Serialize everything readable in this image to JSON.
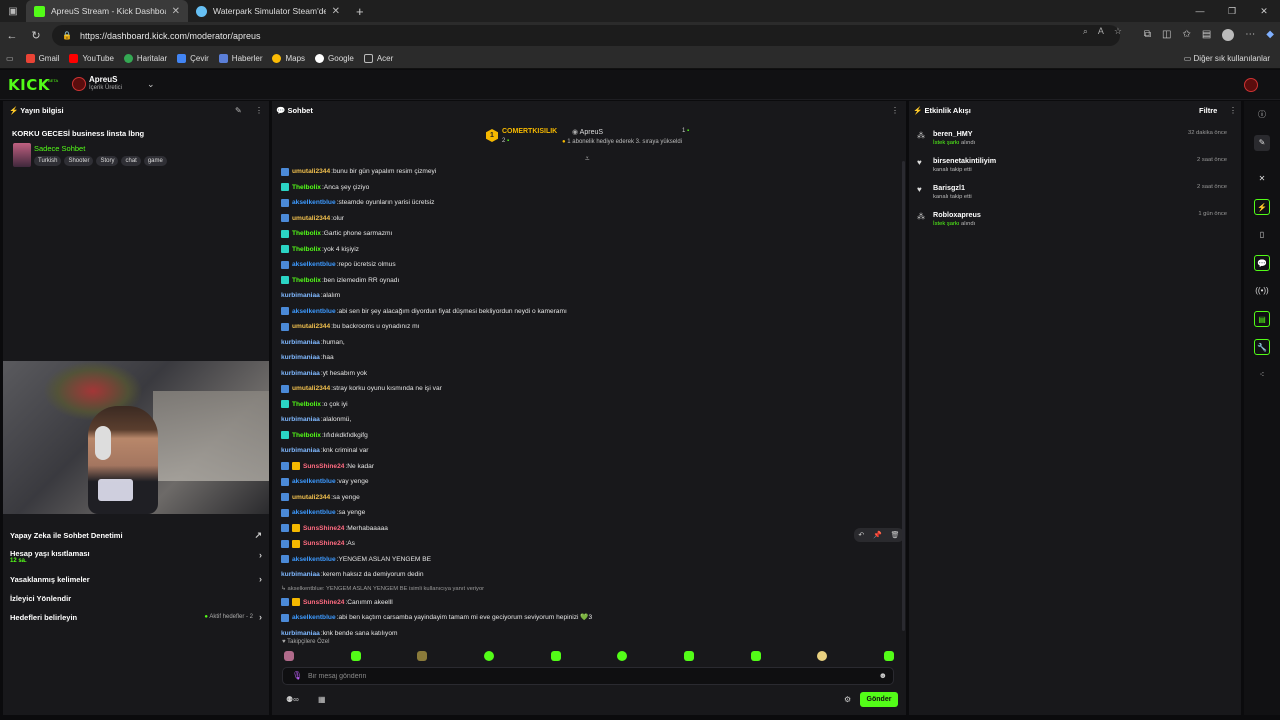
{
  "browser": {
    "tabs": [
      {
        "title": "ApreuS Stream - Kick Dashboard",
        "favicon_color": "#53fc18"
      },
      {
        "title": "Waterpark Simulator Steam'de",
        "favicon_color": "#66c0f4"
      }
    ],
    "url": "https://dashboard.kick.com/moderator/apreus",
    "bookmarks": [
      "Gmail",
      "YouTube",
      "Haritalar",
      "Çevir",
      "Haberler",
      "Maps",
      "Google",
      "Acer"
    ],
    "bookmark_colors": [
      "#ea4335",
      "#ff0000",
      "#34a853",
      "#4285f4",
      "#5b7fd8",
      "#fbbc05",
      "#ffffff",
      "#bbbbbb"
    ],
    "other_bookmarks": "Diğer sık kullanılanlar"
  },
  "header": {
    "logo": "KICK",
    "logo_badge": "BETA",
    "channel_name": "ApreuS",
    "channel_role": "İçerik Üretici"
  },
  "stream_info": {
    "title": "Yayın bilgisi",
    "stream_title": "KORKU GECESİ business linsta lbng",
    "category": "Sadece Sohbet",
    "tags": [
      "Turkish",
      "Shooter",
      "Story",
      "chat",
      "game"
    ]
  },
  "left_menu": {
    "ai_mod": "Yapay Zeka ile Sohbet Denetimi",
    "age_limit": "Hesap yaşı kısıtlaması",
    "age_limit_value": "12 sa.",
    "banned_words": "Yasaklanmış kelimeler",
    "viewer_redirect": "İzleyici Yönlendir",
    "goals": "Hedefleri belirleyin",
    "goals_status": "Aktif hedefler - 2"
  },
  "chat": {
    "title": "Sohbet",
    "pinned": {
      "gifter": "COMERTKISILIK",
      "gifter_count": "2",
      "recipient": "ApreuS",
      "recipient_count": "1",
      "message": "1 abonelik hediye ederek 3. sıraya yükseldi"
    },
    "messages": [
      {
        "user": "umutali2344",
        "color": "orange",
        "badge": "sub",
        "text": "bunu bir gün yapalım resim çizmeyi"
      },
      {
        "user": "Thelbolix",
        "color": "green",
        "badge": "tw",
        "text": "Anca şey çiziyo"
      },
      {
        "user": "akselkentblue",
        "color": "blue",
        "badge": "sub",
        "text": "steamde oyunların yarisi ücretsiz"
      },
      {
        "user": "umutali2344",
        "color": "orange",
        "badge": "sub",
        "text": "olur"
      },
      {
        "user": "Thelbolix",
        "color": "green",
        "badge": "tw",
        "text": "Gartic phone sarmazmı"
      },
      {
        "user": "Thelbolix",
        "color": "green",
        "badge": "tw",
        "text": "yok 4 kişiyiz"
      },
      {
        "user": "akselkentblue",
        "color": "blue",
        "badge": "sub",
        "text": "repo ücretsiz olmus"
      },
      {
        "user": "Thelbolix",
        "color": "green",
        "badge": "tw",
        "text": "ben izlemedim RR oynadı"
      },
      {
        "user": "kurbimaniaa",
        "color": "lightblue",
        "badge": "",
        "text": "alalım"
      },
      {
        "user": "akselkentblue",
        "color": "blue",
        "badge": "sub",
        "text": "abi sen bir şey alacağım diyordun fiyat düşmesi bekliyordun neydi o kameramı"
      },
      {
        "user": "umutali2344",
        "color": "orange",
        "badge": "sub",
        "text": "bu backrooms u oynadınız mı"
      },
      {
        "user": "kurbimaniaa",
        "color": "lightblue",
        "badge": "",
        "text": "human,"
      },
      {
        "user": "kurbimaniaa",
        "color": "lightblue",
        "badge": "",
        "text": "haa"
      },
      {
        "user": "kurbimaniaa",
        "color": "lightblue",
        "badge": "",
        "text": "yt hesabım yok"
      },
      {
        "user": "umutali2344",
        "color": "orange",
        "badge": "sub",
        "text": "stray korku oyunu kısmında ne işi var"
      },
      {
        "user": "Thelbolix",
        "color": "green",
        "badge": "tw",
        "text": "o çok iyi"
      },
      {
        "user": "kurbimaniaa",
        "color": "lightblue",
        "badge": "",
        "text": "alalonmü,"
      },
      {
        "user": "Thelbolix",
        "color": "green",
        "badge": "tw",
        "text": "lıfıdıkdkfıdkgifg"
      },
      {
        "user": "kurbimaniaa",
        "color": "lightblue",
        "badge": "",
        "text": "knk criminal var"
      },
      {
        "user": "SunsShine24",
        "color": "pink",
        "badge": "gold",
        "text": "Ne kadar"
      },
      {
        "user": "akselkentblue",
        "color": "blue",
        "badge": "sub",
        "text": "vay yenge"
      },
      {
        "user": "umutali2344",
        "color": "orange",
        "badge": "sub",
        "text": "sa yenge"
      },
      {
        "user": "akselkentblue",
        "color": "blue",
        "badge": "sub",
        "text": "sa yenge"
      },
      {
        "user": "SunsShine24",
        "color": "pink",
        "badge": "gold",
        "text": "Merhabaaaaa"
      },
      {
        "user": "SunsShine24",
        "color": "pink",
        "badge": "gold",
        "text": "As"
      },
      {
        "user": "akselkentblue",
        "color": "blue",
        "badge": "sub",
        "text": "YENGEM ASLAN YENGEM BE"
      },
      {
        "user": "kurbimaniaa",
        "color": "lightblue",
        "badge": "",
        "text": "kerem haksız da demiyorum dedin"
      }
    ],
    "reply_context": "akselkentblue: YENGEM ASLAN YENGEM BE isimli kullanıcıya yanıt veriyor",
    "messages_after": [
      {
        "user": "SunsShine24",
        "color": "pink",
        "badge": "gold",
        "text": "Canımm akeelll"
      },
      {
        "user": "akselkentblue",
        "color": "blue",
        "badge": "sub",
        "text": "abi ben kaçtım carsamba yayindayim tamam mi eve geciyorum seviyorum hepinizi 💚3"
      },
      {
        "user": "kurbimaniaa",
        "color": "lightblue",
        "badge": "",
        "text": "knk bende sana katılıyom"
      }
    ],
    "followers_only": "Takipçilere Özel",
    "input_placeholder": "Bir mesaj gönderin",
    "send_label": "Gönder"
  },
  "events": {
    "title": "Etkinlik Akışı",
    "filter": "Filtre",
    "items": [
      {
        "name": "beren_HMY",
        "highlight": "İstek şarkı",
        "desc": " alındı",
        "time": "32 dakika önce",
        "icon": "gift"
      },
      {
        "name": "birsenetakintiliyim",
        "highlight": "",
        "desc": "kanalı takip etti",
        "time": "2 saat önce",
        "icon": "heart"
      },
      {
        "name": "Barisgzl1",
        "highlight": "",
        "desc": "kanalı takip etti",
        "time": "2 saat önce",
        "icon": "heart"
      },
      {
        "name": "Robloxapreus",
        "highlight": "İstek şarkı",
        "desc": " alındı",
        "time": "1 gün önce",
        "icon": "gift"
      }
    ]
  },
  "colors": {
    "accent": "#53fc18",
    "panel": "#18181b",
    "background": "#0b0b0d"
  }
}
